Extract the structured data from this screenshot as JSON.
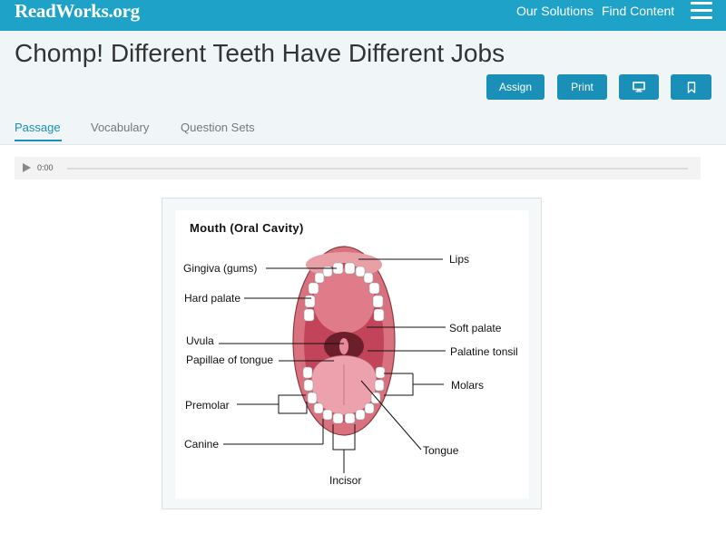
{
  "topbar": {
    "logo": "ReadWorks.org",
    "nav": {
      "solutions": "Our Solutions",
      "find": "Find Content"
    }
  },
  "page": {
    "title": "Chomp! Different Teeth Have Different Jobs"
  },
  "actions": {
    "assign": "Assign",
    "print": "Print"
  },
  "tabs": {
    "passage": "Passage",
    "vocabulary": "Vocabulary",
    "question_sets": "Question Sets"
  },
  "audio": {
    "time": "0:00"
  },
  "diagram": {
    "title": "Mouth (Oral Cavity)",
    "labels": {
      "gingiva": "Gingiva (gums)",
      "hard_palate": "Hard palate",
      "uvula": "Uvula",
      "papillae": "Papillae of tongue",
      "premolar": "Premolar",
      "canine": "Canine",
      "incisor": "Incisor",
      "lips": "Lips",
      "soft_palate": "Soft palate",
      "palatine_tonsil": "Palatine tonsil",
      "molars": "Molars",
      "tongue": "Tongue"
    }
  },
  "colors": {
    "brand": "#1ea2c7",
    "button": "#1a90b8",
    "active_tab": "#1a90b8"
  },
  "icons": {
    "menu": "hamburger-menu-icon",
    "screen": "monitor-icon",
    "bookmark": "bookmark-icon",
    "play": "play-icon"
  }
}
